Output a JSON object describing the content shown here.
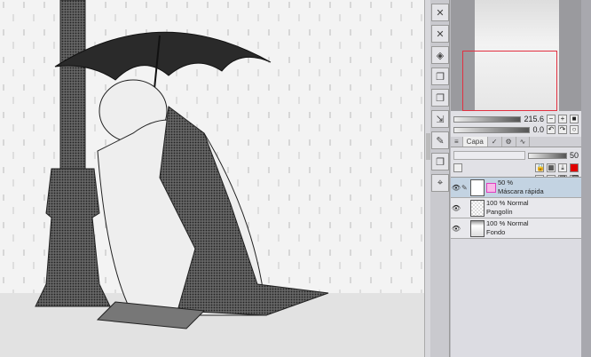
{
  "navigator": {
    "zoom": "215.6",
    "rotation": "0.0"
  },
  "panel": {
    "tabs": [
      {
        "label": "Capa",
        "active": true
      }
    ],
    "opacity": "50",
    "color_swatch": "#e00000",
    "layers": [
      {
        "opacity": "50 %",
        "blend": "",
        "name": "Máscara rápida",
        "selected": true
      },
      {
        "opacity": "100 %",
        "blend": "Normal",
        "name": "Pangolín",
        "selected": false
      },
      {
        "opacity": "100 %",
        "blend": "Normal",
        "name": "Fondo",
        "selected": false
      }
    ]
  },
  "colors": {
    "accent": "#e23040",
    "selected_layer": "#c3d3e2",
    "mask": "#e040c0"
  }
}
